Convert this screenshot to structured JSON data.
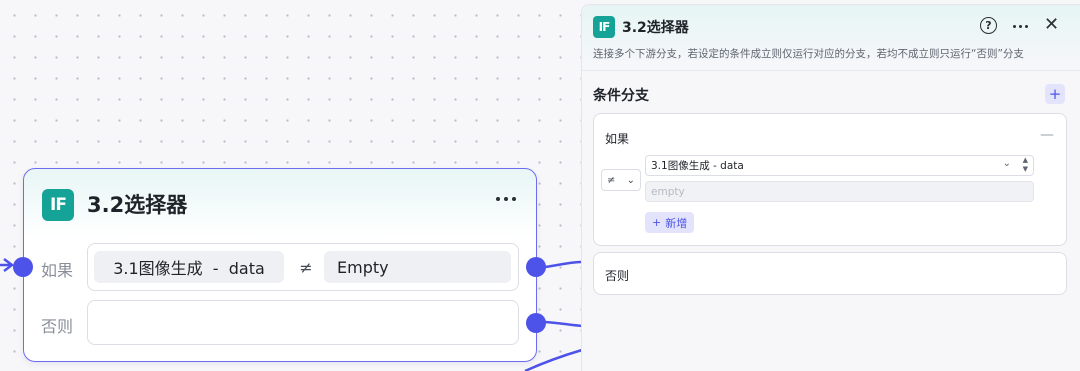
{
  "node": {
    "icon_text": "IF",
    "title": "3.2选择器",
    "if_label": "如果",
    "else_label": "否则",
    "condition": {
      "left": "3.1图像生成  -  data",
      "operator": "≠",
      "right": "Empty"
    },
    "icons": [
      "if-icon",
      "more-icon"
    ]
  },
  "panel": {
    "icon_text": "IF",
    "title": "3.2选择器",
    "help_symbol": "?",
    "close_symbol": "✕",
    "description": "连接多个下游分支，若设定的条件成立则仅运行对应的分支，若均不成立则只运行“否则”分支",
    "section_title": "条件分支",
    "add_symbol": "+",
    "if_card": {
      "label": "如果",
      "collapse_symbol": "—",
      "operator": "≠",
      "operator_chevron": "⌄",
      "variable": "3.1图像生成 - data",
      "variable_chevron": "⌄",
      "value_placeholder": "empty",
      "add_label": "新增",
      "add_symbol": "+"
    },
    "else_card": {
      "label": "否则"
    }
  },
  "colors": {
    "accent": "#4d53e8",
    "if_icon": "#14a396"
  }
}
